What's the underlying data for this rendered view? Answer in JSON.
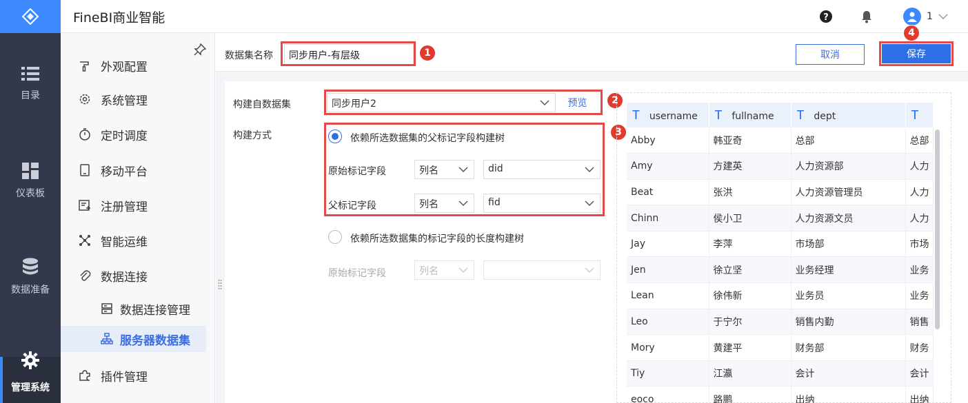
{
  "app": {
    "brand": "FineBI商业智能"
  },
  "header": {
    "user_name": "1"
  },
  "rail": {
    "items": [
      {
        "label": "目录",
        "icon": "list-icon"
      },
      {
        "label": "仪表板",
        "icon": "dashboard-icon"
      },
      {
        "label": "数据准备",
        "icon": "database-icon"
      },
      {
        "label": "管理系统",
        "icon": "gear-icon"
      }
    ]
  },
  "sidebar": {
    "items": [
      {
        "label": "外观配置",
        "icon": "palette-icon"
      },
      {
        "label": "系统管理",
        "icon": "settings-icon"
      },
      {
        "label": "定时调度",
        "icon": "timer-icon"
      },
      {
        "label": "移动平台",
        "icon": "tablet-icon"
      },
      {
        "label": "注册管理",
        "icon": "register-icon"
      },
      {
        "label": "智能运维",
        "icon": "network-icon"
      },
      {
        "label": "数据连接",
        "icon": "paperclip-icon"
      },
      {
        "label": "数据连接管理",
        "icon": "server-icon"
      },
      {
        "label": "服务器数据集",
        "icon": "hierarchy-icon"
      },
      {
        "label": "插件管理",
        "icon": "puzzle-icon"
      }
    ]
  },
  "form": {
    "dataset_name_label": "数据集名称",
    "dataset_name_value": "同步用户-有层级",
    "cancel_label": "取消",
    "save_label": "保存",
    "source_label": "构建自数据集",
    "source_value": "同步用户2",
    "preview_label": "预览",
    "method_label": "构建方式",
    "option1_label": "依赖所选数据集的父标记字段构建树",
    "original_field_label": "原始标记字段",
    "original_col_value": "列名",
    "original_field_value": "did",
    "parent_field_label": "父标记字段",
    "parent_col_value": "列名",
    "parent_field_value": "fid",
    "option2_label": "依赖所选数据集的标记字段的长度构建树",
    "option2_original_label": "原始标记字段",
    "option2_col_value": "列名",
    "option2_field_value": ""
  },
  "annotations": [
    "1",
    "2",
    "3",
    "4"
  ],
  "grid": {
    "columns": [
      "username",
      "fullname",
      "dept",
      ""
    ],
    "rows": [
      [
        "Abby",
        "韩亚奇",
        "总部",
        "总部"
      ],
      [
        "Amy",
        "方建英",
        "人力资源部",
        "人力"
      ],
      [
        "Beat",
        "张洪",
        "人力资源管理员",
        "人力"
      ],
      [
        "Chinn",
        "侯小卫",
        "人力资源文员",
        "人力"
      ],
      [
        "Jay",
        "李萍",
        "市场部",
        "市场"
      ],
      [
        "Jen",
        "徐立坚",
        "业务经理",
        "业务"
      ],
      [
        "Lean",
        "徐伟新",
        "业务员",
        "业务"
      ],
      [
        "Leo",
        "于宁尔",
        "销售内勤",
        "销售"
      ],
      [
        "Mory",
        "黄建平",
        "财务部",
        "财务"
      ],
      [
        "Tiy",
        "江瀛",
        "会计",
        "会计"
      ],
      [
        "eoco",
        "路鹏",
        "出纳",
        "出纳"
      ]
    ]
  }
}
